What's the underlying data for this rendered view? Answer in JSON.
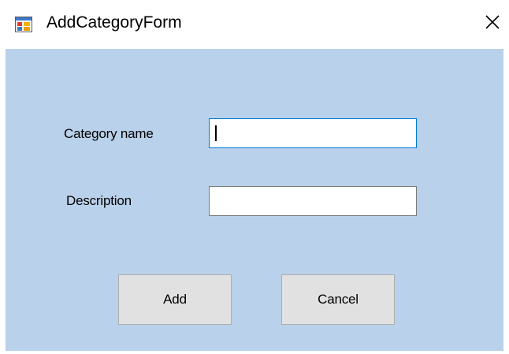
{
  "window": {
    "title": "AddCategoryForm",
    "icon": "winforms-app-icon",
    "close_icon": "close-icon"
  },
  "form": {
    "background": "#b9d1ea",
    "category_name": {
      "label": "Category name",
      "value": "",
      "placeholder": ""
    },
    "description": {
      "label": "Description",
      "value": "",
      "placeholder": ""
    }
  },
  "buttons": {
    "add_label": "Add",
    "cancel_label": "Cancel"
  },
  "colors": {
    "focus_border": "#0078d7",
    "button_face": "#e1e1e1"
  }
}
